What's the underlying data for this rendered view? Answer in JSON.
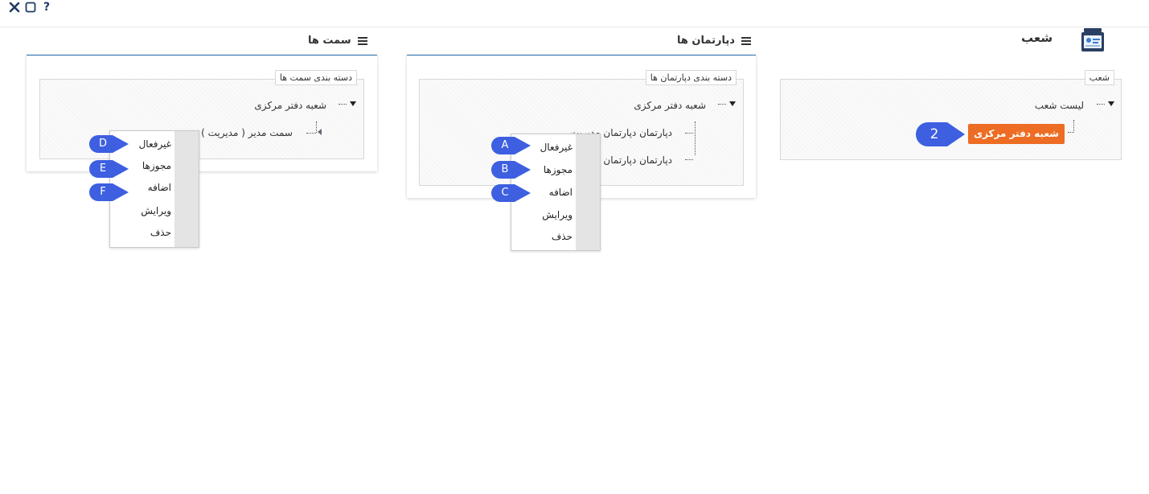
{
  "window": {
    "help": "?",
    "maximize_icon": "maximize-icon",
    "close_icon": "close-icon"
  },
  "page": {
    "title": "شعب",
    "icon": "branch-card-icon"
  },
  "branches": {
    "legend": "شعب",
    "tree_root": "لیست شعب",
    "selected_button": "شعبه دفتر مرکزی",
    "callout": "2"
  },
  "departments": {
    "title": "دپارتمان ها",
    "legend": "دسته بندی دپارتمان ها",
    "tree_root": "شعبه دفتر مرکزی",
    "children": [
      "دپارتمان دپارتمان مدیریت",
      "دپارتمان دپارتمان"
    ],
    "menu": [
      "غیرفعال",
      "مجوزها",
      "اضافه",
      "ویرایش",
      "حذف"
    ],
    "callouts": [
      "A",
      "B",
      "C"
    ]
  },
  "positions": {
    "title": "سمت ها",
    "legend": "دسته بندی سمت ها",
    "tree_root": "شعبه دفتر مرکزی",
    "child": "سمت مدیر ( مدیریت )",
    "menu": [
      "غیرفعال",
      "مجوزها",
      "اضافه",
      "ویرایش",
      "حذف"
    ],
    "callouts": [
      "D",
      "E",
      "F"
    ]
  },
  "colors": {
    "accent": "#ec6d23",
    "callout": "#3d5fe0",
    "header_line": "#2b6cb0"
  }
}
